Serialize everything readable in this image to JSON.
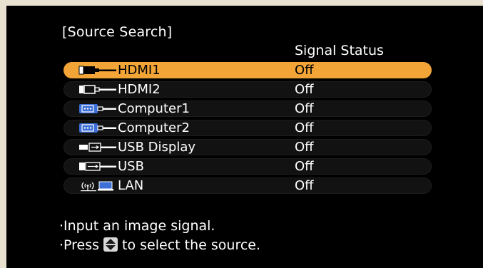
{
  "panel": {
    "title": "[Source Search]",
    "column_header": "Signal Status"
  },
  "sources": [
    {
      "name": "HDMI1",
      "status": "Off",
      "icon": "hdmi-icon",
      "selected": true
    },
    {
      "name": "HDMI2",
      "status": "Off",
      "icon": "hdmi-icon",
      "selected": false
    },
    {
      "name": "Computer1",
      "status": "Off",
      "icon": "vga-computer-icon",
      "selected": false
    },
    {
      "name": "Computer2",
      "status": "Off",
      "icon": "vga-computer-icon",
      "selected": false
    },
    {
      "name": "USB Display",
      "status": "Off",
      "icon": "usb-display-icon",
      "selected": false
    },
    {
      "name": "USB",
      "status": "Off",
      "icon": "usb-icon",
      "selected": false
    },
    {
      "name": "LAN",
      "status": "Off",
      "icon": "lan-wireless-icon",
      "selected": false
    }
  ],
  "help": {
    "line1": "·Input an image signal.",
    "line2_before": "·Press",
    "line2_after": "to select the source."
  },
  "colors": {
    "highlight": "#f2a437",
    "panel_bg": "#000000",
    "icon_blue": "#3d6fd8"
  }
}
